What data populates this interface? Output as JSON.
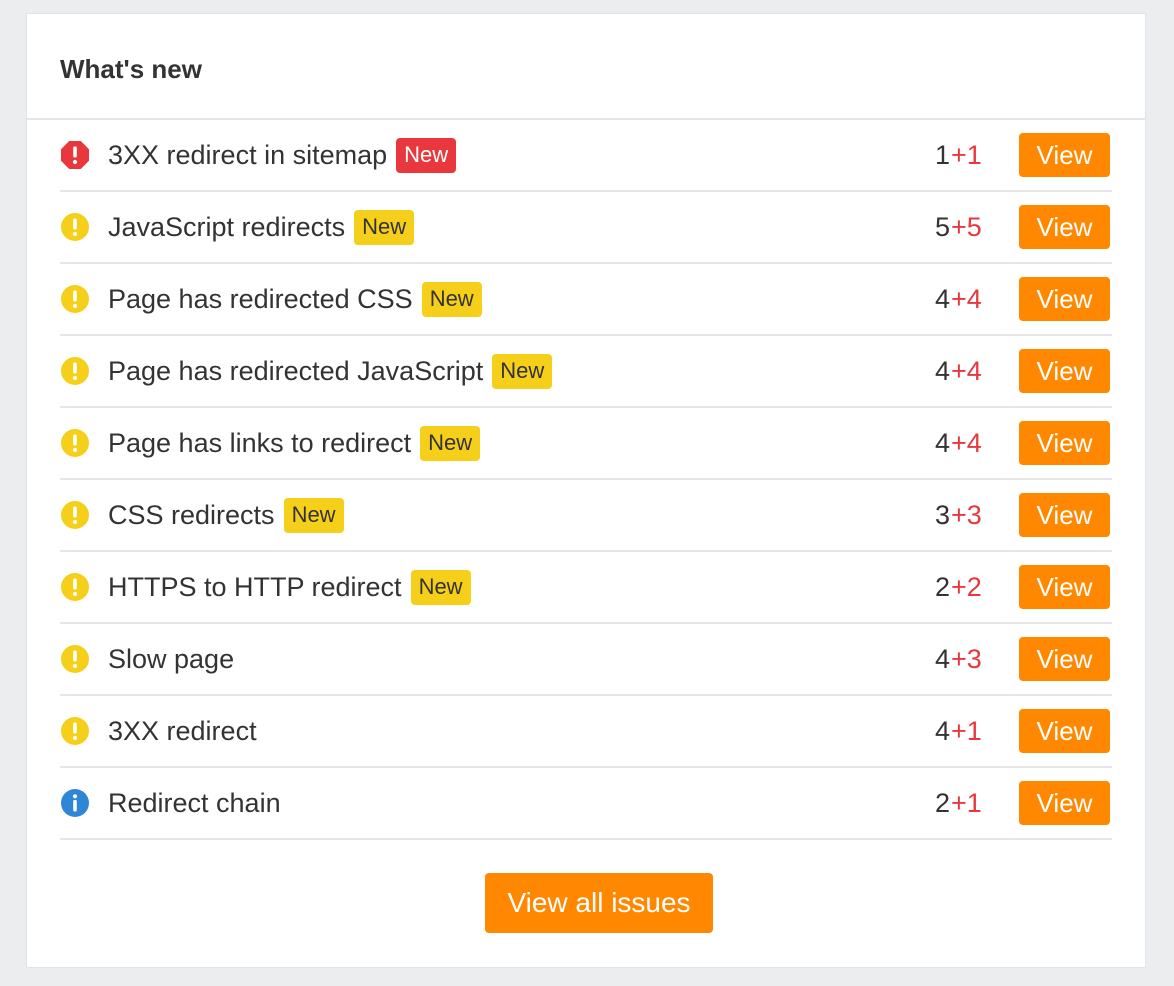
{
  "card": {
    "title": "What's new"
  },
  "colors": {
    "error": "#e8383d",
    "warning": "#f6cf1a",
    "notice": "#2f86d6",
    "accent": "#ff8800",
    "delta": "#e8383d"
  },
  "issues": [
    {
      "severity": "error",
      "icon": "error-octagon-icon",
      "name": "3XX redirect in sitemap",
      "badge": "New",
      "count": "1",
      "delta": "+1",
      "action": "View"
    },
    {
      "severity": "warning",
      "icon": "warning-circle-icon",
      "name": "JavaScript redirects",
      "badge": "New",
      "count": "5",
      "delta": "+5",
      "action": "View"
    },
    {
      "severity": "warning",
      "icon": "warning-circle-icon",
      "name": "Page has redirected CSS",
      "badge": "New",
      "count": "4",
      "delta": "+4",
      "action": "View"
    },
    {
      "severity": "warning",
      "icon": "warning-circle-icon",
      "name": "Page has redirected JavaScript",
      "badge": "New",
      "count": "4",
      "delta": "+4",
      "action": "View"
    },
    {
      "severity": "warning",
      "icon": "warning-circle-icon",
      "name": "Page has links to redirect",
      "badge": "New",
      "count": "4",
      "delta": "+4",
      "action": "View"
    },
    {
      "severity": "warning",
      "icon": "warning-circle-icon",
      "name": "CSS redirects",
      "badge": "New",
      "count": "3",
      "delta": "+3",
      "action": "View"
    },
    {
      "severity": "warning",
      "icon": "warning-circle-icon",
      "name": "HTTPS to HTTP redirect",
      "badge": "New",
      "count": "2",
      "delta": "+2",
      "action": "View"
    },
    {
      "severity": "warning",
      "icon": "warning-circle-icon",
      "name": "Slow page",
      "badge": "",
      "count": "4",
      "delta": "+3",
      "action": "View"
    },
    {
      "severity": "warning",
      "icon": "warning-circle-icon",
      "name": "3XX redirect",
      "badge": "",
      "count": "4",
      "delta": "+1",
      "action": "View"
    },
    {
      "severity": "notice",
      "icon": "info-circle-icon",
      "name": "Redirect chain",
      "badge": "",
      "count": "2",
      "delta": "+1",
      "action": "View"
    }
  ],
  "footer": {
    "view_all_label": "View all issues"
  }
}
